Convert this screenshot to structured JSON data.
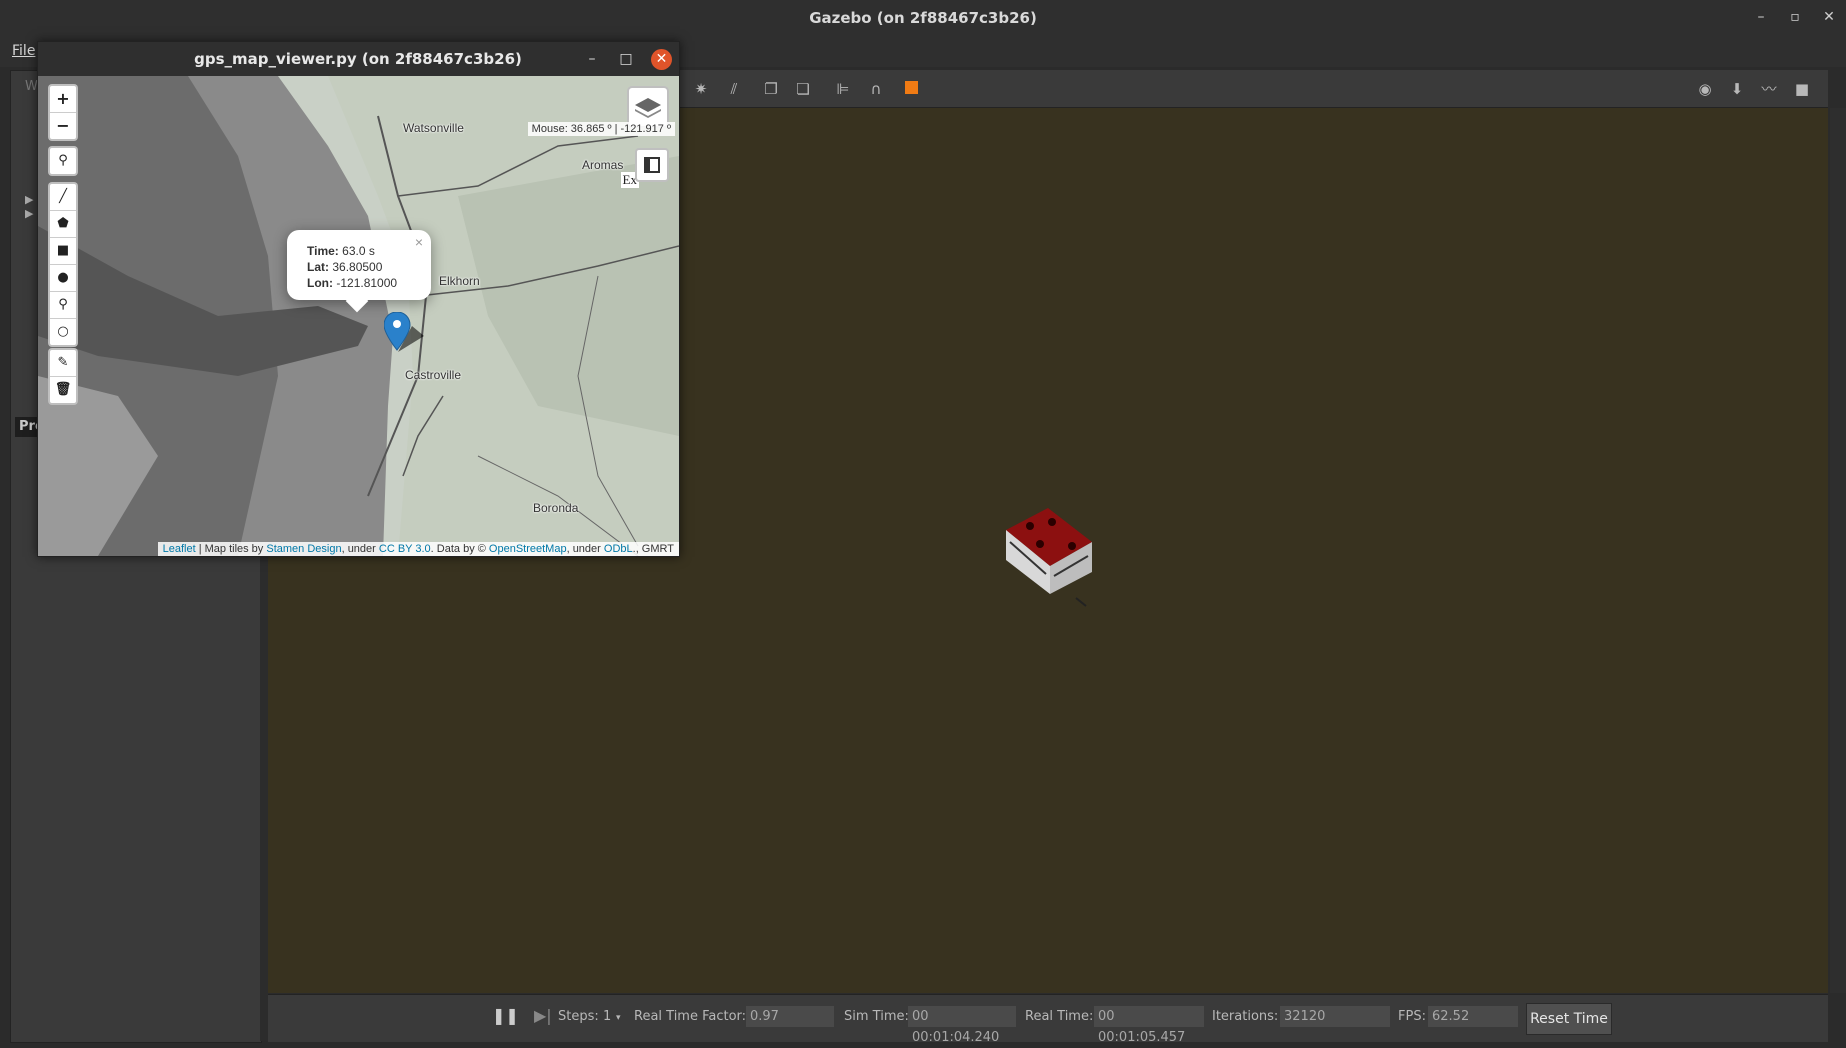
{
  "window": {
    "title": "Gazebo (on 2f88467c3b26)",
    "menu_file": "File"
  },
  "left_panel": {
    "world_label": "W",
    "properties_label": "Pro"
  },
  "popup_window": {
    "title": "gps_map_viewer.py (on 2f88467c3b26)"
  },
  "map": {
    "zoom_in": "+",
    "zoom_out": "−",
    "mouse_position": "Mouse: 36.865 º | -121.917 º",
    "export_partial": "Ex",
    "places": [
      {
        "name": "Watsonville"
      },
      {
        "name": "Aromas"
      },
      {
        "name": "Elkhorn"
      },
      {
        "name": "Castroville"
      },
      {
        "name": "Boronda"
      }
    ],
    "marker_popup": {
      "time_label": "Time:",
      "time_value": "63.0 s",
      "lat_label": "Lat:",
      "lat_value": "36.80500",
      "lon_label": "Lon:",
      "lon_value": "-121.81000",
      "close": "×"
    },
    "attribution": {
      "leaflet": "Leaflet",
      "text1": " | Map tiles by ",
      "stamen": "Stamen Design",
      "text2": ", under ",
      "ccby": "CC BY 3.0",
      "text3": ". Data by © ",
      "osm": "OpenStreetMap",
      "text4": ", under ",
      "odbl": "ODbL",
      "text5": "., GMRT"
    }
  },
  "bottom_bar": {
    "steps_label": "Steps:",
    "steps_value": "1",
    "rtf_label": "Real Time Factor:",
    "rtf_value": "0.97",
    "sim_time_label": "Sim Time:",
    "sim_time_value": "00 00:01:04.240",
    "real_time_label": "Real Time:",
    "real_time_value": "00 00:01:05.457",
    "iterations_label": "Iterations:",
    "iterations_value": "32120",
    "fps_label": "FPS:",
    "fps_value": "62.52",
    "reset_label": "Reset Time"
  },
  "colors": {
    "viewport_bg": "#38321f",
    "close_accent": "#e0542a",
    "link": "#0078a8",
    "marker": "#2a81cb"
  }
}
